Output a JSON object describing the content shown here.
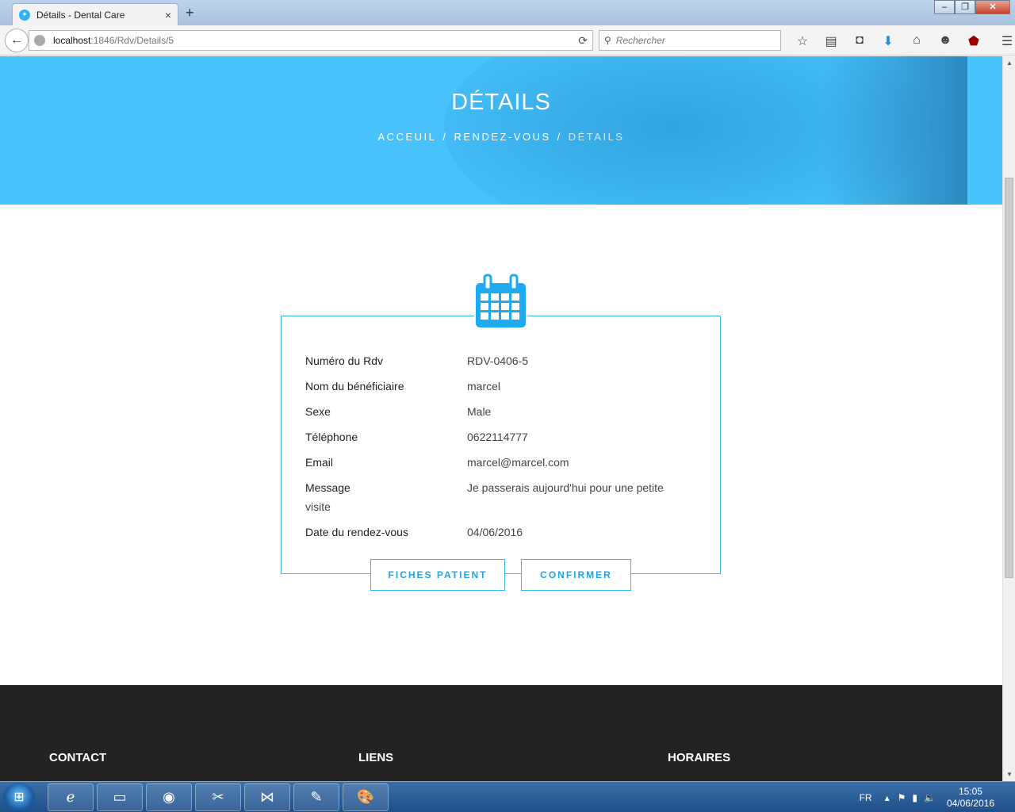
{
  "browser": {
    "tab_title": "Détails - Dental Care",
    "tab_close": "×",
    "new_tab": "+",
    "url_host": "localhost",
    "url_path": ":1846/Rdv/Details/5",
    "search_placeholder": "Rechercher",
    "window_buttons": [
      "–",
      "❐",
      "✕"
    ]
  },
  "hero": {
    "title": "DÉTAILS",
    "breadcrumb": [
      "ACCEUIL",
      "RENDEZ-VOUS",
      "DÉTAILS"
    ],
    "separator": "/"
  },
  "details": {
    "rows": [
      {
        "label": "Numéro du Rdv",
        "value": "RDV-0406-5"
      },
      {
        "label": "Nom du bénéficiaire",
        "value": "marcel"
      },
      {
        "label": "Sexe",
        "value": "Male"
      },
      {
        "label": "Téléphone",
        "value": "0622114777"
      },
      {
        "label": "Email",
        "value": "marcel@marcel.com"
      },
      {
        "label": "Message",
        "value": "Je passerais aujourd'hui pour une petite",
        "value_cont": "visite"
      },
      {
        "label": "Date du rendez-vous",
        "value": "04/06/2016"
      }
    ],
    "buttons": {
      "patient": "FICHES PATIENT",
      "confirm": "CONFIRMER"
    }
  },
  "footer": {
    "contact": "CONTACT",
    "links": "LIENS",
    "hours": "HORAIRES"
  },
  "taskbar": {
    "lang": "FR",
    "time": "15:05",
    "date": "04/06/2016"
  },
  "colors": {
    "accent": "#48c2fb",
    "border": "#38b6ef",
    "footer": "#232323"
  }
}
